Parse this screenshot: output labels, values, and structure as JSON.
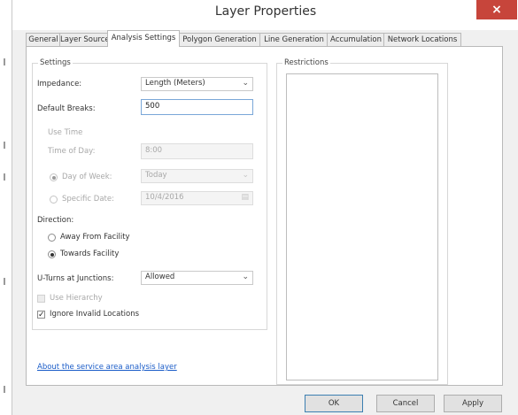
{
  "window": {
    "title": "Layer Properties",
    "close_glyph": "×"
  },
  "tabs": [
    {
      "label": "General",
      "active": false
    },
    {
      "label": "Layer Source",
      "active": false
    },
    {
      "label": "Analysis Settings",
      "active": true
    },
    {
      "label": "Polygon Generation",
      "active": false
    },
    {
      "label": "Line Generation",
      "active": false
    },
    {
      "label": "Accumulation",
      "active": false
    },
    {
      "label": "Network Locations",
      "active": false
    }
  ],
  "settings": {
    "group_label": "Settings",
    "impedance_label": "Impedance:",
    "impedance_value": "Length (Meters)",
    "default_breaks_label": "Default Breaks:",
    "default_breaks_value": "500",
    "use_time_label": "Use Time",
    "time_of_day_label": "Time of Day:",
    "time_of_day_value": "8:00",
    "day_of_week_label": "Day of Week:",
    "day_of_week_value": "Today",
    "specific_date_label": "Specific Date:",
    "specific_date_value": "10/4/2016",
    "direction_label": "Direction:",
    "away_from_facility_label": "Away From Facility",
    "towards_facility_label": "Towards Facility",
    "u_turns_label": "U-Turns at Junctions:",
    "u_turns_value": "Allowed",
    "use_hierarchy_label": "Use Hierarchy",
    "ignore_invalid_label": "Ignore Invalid Locations",
    "ignore_invalid_checked": true
  },
  "restrictions": {
    "group_label": "Restrictions"
  },
  "about_link": "About the service area analysis layer",
  "buttons": {
    "ok": "OK",
    "cancel": "Cancel",
    "apply": "Apply"
  },
  "colors": {
    "close_button": "#c7453b",
    "link": "#1a5cc8",
    "focus_border": "#7aa7d8"
  }
}
